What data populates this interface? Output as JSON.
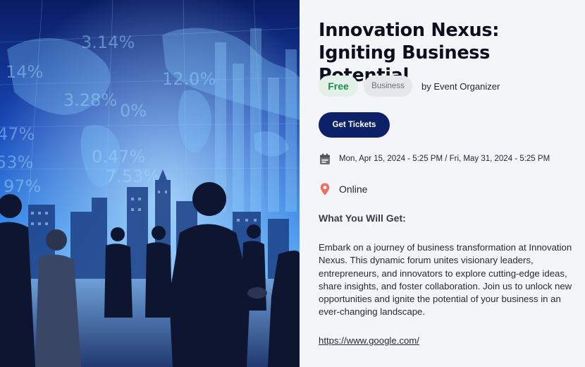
{
  "event": {
    "title": "Innovation Nexus: Igniting Business Potential",
    "price_badge": "Free",
    "category_badge": "Business",
    "organizer_prefix": "by",
    "organizer": "Event Organizer",
    "tickets_label": "Get Tickets",
    "date_range": "Mon, Apr 15, 2024 - 5:25 PM / Fri, May 31, 2024 - 5:25 PM",
    "location": "Online",
    "section_heading": "What You Will Get:",
    "description": "Embark on a journey of business transformation at Innovation Nexus. This dynamic forum unites visionary leaders, entrepreneurs, and innovators to explore cutting-edge ideas, share insights, and foster collaboration. Join us to unlock new opportunities and ignite the potential of your business in an ever-changing landscape.",
    "link_text": "https://www.google.com/"
  },
  "hero": {
    "overlay_numbers": [
      "3.14%",
      "14%",
      "47%",
      "53%",
      "97%",
      "0.47%",
      "3.28%",
      "7.53%",
      "12.0%",
      "0%"
    ]
  },
  "icons": {
    "date": "calendar-icon",
    "location": "map-pin-icon"
  },
  "colors": {
    "primary": "#0c2167",
    "free_badge_bg": "#e3f1e8",
    "free_badge_text": "#1f8a4c",
    "hero_blue": "#1a5fd6"
  }
}
